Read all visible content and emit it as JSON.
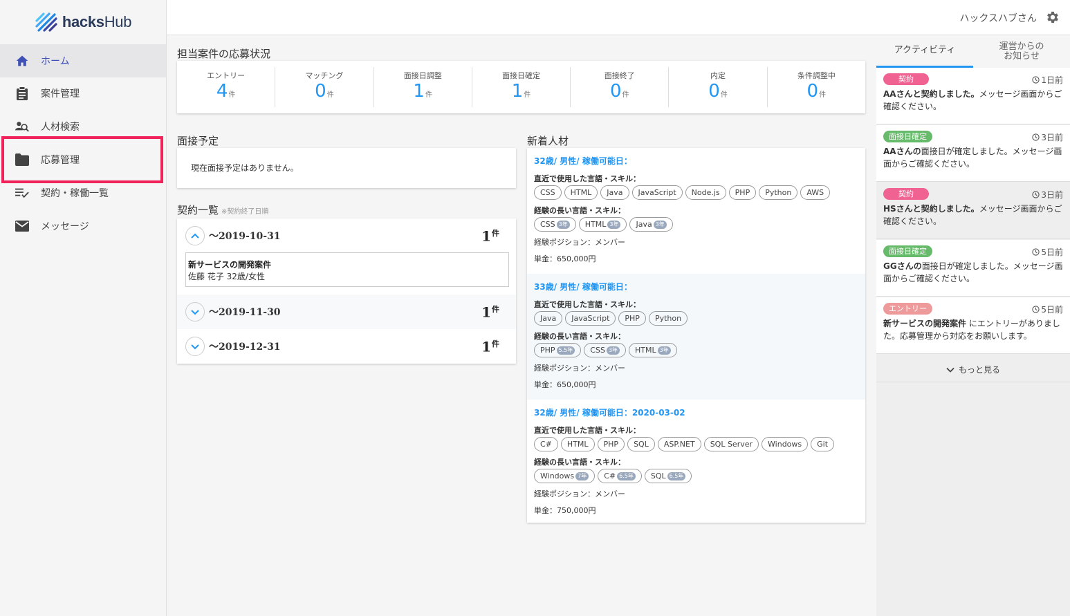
{
  "app": {
    "logo_text_bold": "hacks",
    "logo_text_light": "Hub"
  },
  "sidebar": {
    "items": [
      {
        "label": "ホーム",
        "icon": "home-icon",
        "active": true
      },
      {
        "label": "案件管理",
        "icon": "clipboard-icon"
      },
      {
        "label": "人材検索",
        "icon": "person-search-icon"
      },
      {
        "label": "応募管理",
        "icon": "folder-icon"
      },
      {
        "label": "契約・稼働一覧",
        "icon": "list-check-icon"
      },
      {
        "label": "メッセージ",
        "icon": "mail-icon"
      }
    ]
  },
  "header": {
    "user_name": "ハックスハブさん"
  },
  "status": {
    "title": "担当案件の応募状況",
    "unit": "件",
    "items": [
      {
        "label": "エントリー",
        "value": "4"
      },
      {
        "label": "マッチング",
        "value": "0"
      },
      {
        "label": "面接日調整",
        "value": "1"
      },
      {
        "label": "面接日確定",
        "value": "1"
      },
      {
        "label": "面接終了",
        "value": "0"
      },
      {
        "label": "内定",
        "value": "0"
      },
      {
        "label": "条件調整中",
        "value": "0"
      }
    ]
  },
  "interview": {
    "title": "面接予定",
    "empty_text": "現在面接予定はありません。"
  },
  "contracts": {
    "title": "契約一覧",
    "note": "※契約終了日順",
    "unit": "件",
    "groups": [
      {
        "date": "〜2019-10-31",
        "count": "1",
        "detail_title": "新サービスの開発案件",
        "detail_sub": "佐藤 花子 32歳/女性"
      },
      {
        "date": "〜2019-11-30",
        "count": "1"
      },
      {
        "date": "〜2019-12-31",
        "count": "1"
      }
    ]
  },
  "talents": {
    "title": "新着人材",
    "recent_label": "直近で使用した言語・スキル：",
    "long_label": "経験の長い言語・スキル：",
    "items": [
      {
        "head": "32歳/ 男性/ 稼働可能日：",
        "recent": [
          "CSS",
          "HTML",
          "Java",
          "JavaScript",
          "Node.js",
          "PHP",
          "Python",
          "AWS"
        ],
        "long": [
          {
            "name": "CSS",
            "years": "3年"
          },
          {
            "name": "HTML",
            "years": "3年"
          },
          {
            "name": "Java",
            "years": "3年"
          }
        ],
        "position": "経験ポジション：メンバー",
        "price": "単金：650,000円"
      },
      {
        "head": "33歳/ 男性/ 稼働可能日：",
        "recent": [
          "Java",
          "JavaScript",
          "PHP",
          "Python"
        ],
        "long": [
          {
            "name": "PHP",
            "years": "5.5年"
          },
          {
            "name": "CSS",
            "years": "3年"
          },
          {
            "name": "HTML",
            "years": "3年"
          }
        ],
        "position": "経験ポジション：メンバー",
        "price": "単金：650,000円"
      },
      {
        "head": "32歳/ 男性/ 稼働可能日：2020-03-02",
        "recent": [
          "C#",
          "HTML",
          "PHP",
          "SQL",
          "ASP.NET",
          "SQL Server",
          "Windows",
          "Git"
        ],
        "long": [
          {
            "name": "Windows",
            "years": "7年"
          },
          {
            "name": "C#",
            "years": "6.5年"
          },
          {
            "name": "SQL",
            "years": "6.5年"
          }
        ],
        "position": "経験ポジション：メンバー",
        "price": "単金：750,000円"
      }
    ]
  },
  "activity": {
    "tabs": [
      {
        "label": "アクティビティ",
        "active": true
      },
      {
        "label": "運営からの\nお知らせ"
      }
    ],
    "items": [
      {
        "badge": "契約",
        "badge_color": "#f06292",
        "time": "1日前",
        "bold": "AAさんと契約しました。",
        "text": "メッセージ画面からご確認ください。"
      },
      {
        "badge": "面接日確定",
        "badge_color": "#66bb6a",
        "time": "3日前",
        "bold": "AAさんの",
        "text": "面接日が確定しました。メッセージ画面からご確認ください。"
      },
      {
        "badge": "契約",
        "badge_color": "#f06292",
        "time": "3日前",
        "bold": "HSさんと契約しました。",
        "text": "メッセージ画面からご確認ください。"
      },
      {
        "badge": "面接日確定",
        "badge_color": "#66bb6a",
        "time": "5日前",
        "bold": "GGさんの",
        "text": "面接日が確定しました。メッセージ画面からご確認ください。"
      },
      {
        "badge": "エントリー",
        "badge_color": "#ef9a9a",
        "time": "5日前",
        "bold": "新サービスの開発案件",
        "text": " にエントリーがありました。応募管理から対応をお願いします。"
      }
    ],
    "more_label": "もっと見る"
  }
}
